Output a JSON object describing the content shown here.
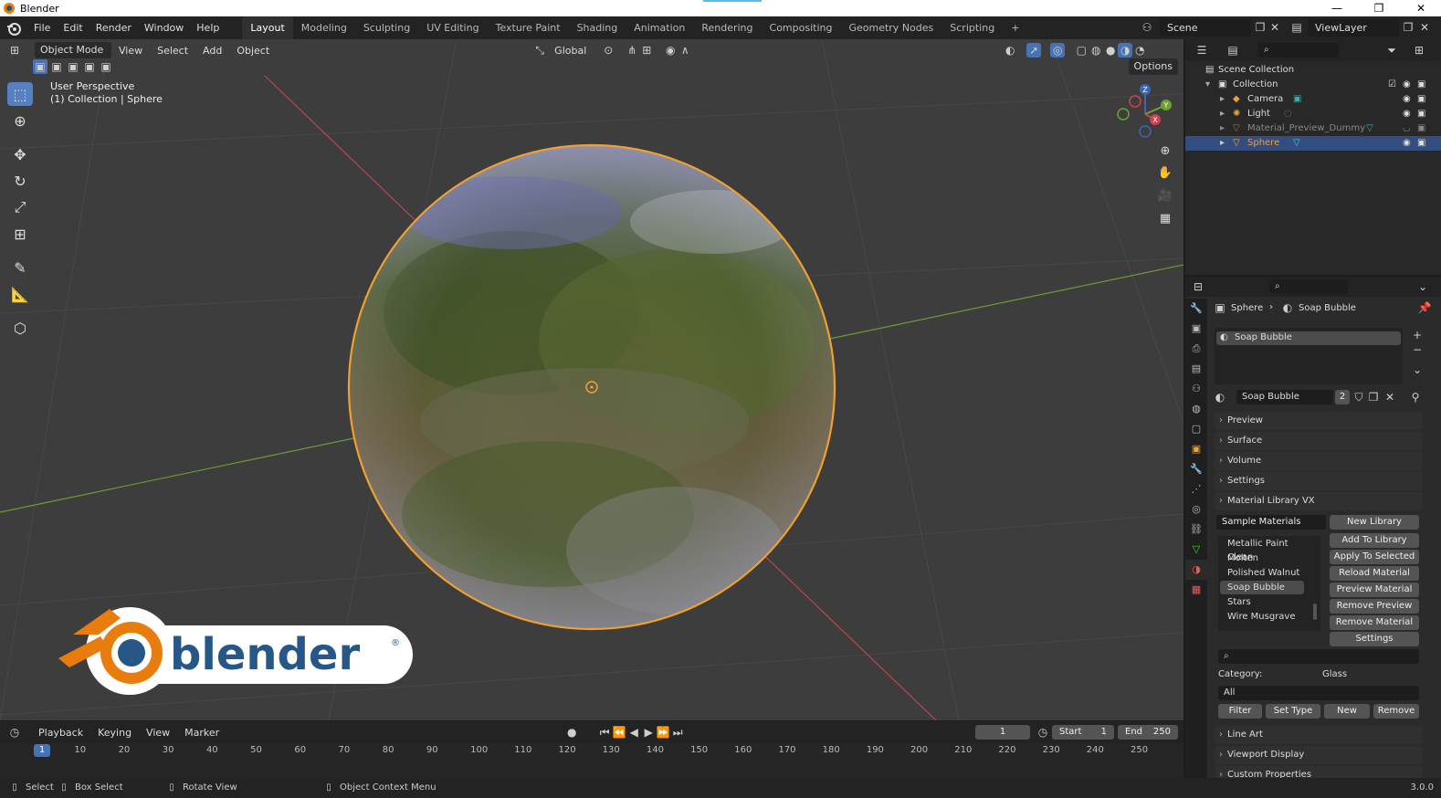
{
  "titlebar": {
    "title": "Blender",
    "minimize": "—",
    "maximize": "❐",
    "close": "✕"
  },
  "menu": [
    "File",
    "Edit",
    "Render",
    "Window",
    "Help"
  ],
  "workspaces": [
    "Layout",
    "Modeling",
    "Sculpting",
    "UV Editing",
    "Texture Paint",
    "Shading",
    "Animation",
    "Rendering",
    "Compositing",
    "Geometry Nodes",
    "Scripting",
    "+"
  ],
  "scene": {
    "label": "Scene",
    "view_layer": "ViewLayer"
  },
  "viewport": {
    "mode": "Object Mode",
    "menus": [
      "View",
      "Select",
      "Add",
      "Object"
    ],
    "transform": "Global",
    "options": "Options",
    "perspective": "User Perspective",
    "collection_info": "(1) Collection | Sphere",
    "gizmo_axes": [
      "Z",
      "Y",
      "X"
    ]
  },
  "logo": {
    "text": "blender",
    "mark": "®"
  },
  "outliner": {
    "items": [
      {
        "label": "Scene Collection"
      },
      {
        "label": "Collection"
      },
      {
        "label": "Camera"
      },
      {
        "label": "Light"
      },
      {
        "label": "Material_Preview_Dummy"
      },
      {
        "label": "Sphere"
      }
    ]
  },
  "properties": {
    "breadcrumb": {
      "object": "Sphere",
      "material": "Soap Bubble"
    },
    "slot": "Soap Bubble",
    "material_name": "Soap Bubble",
    "users": "2",
    "panels": [
      "Preview",
      "Surface",
      "Volume",
      "Settings",
      "Material Library VX"
    ],
    "library": {
      "selected": "Sample Materials",
      "materials": [
        "Metallic Paint Clean",
        "Molten",
        "Polished Walnut",
        "Soap Bubble",
        "Stars",
        "Wire Musgrave"
      ],
      "buttons": [
        "New Library",
        "Add To Library",
        "Apply To Selected",
        "Reload Material",
        "Preview Material",
        "Remove Preview",
        "Remove Material",
        "Settings"
      ],
      "category_label": "Category:",
      "category_value": "Glass",
      "filter_value": "All",
      "bottom_buttons": [
        "Filter",
        "Set Type",
        "New",
        "Remove"
      ]
    },
    "lower_panels": [
      "Line Art",
      "Viewport Display",
      "Custom Properties"
    ]
  },
  "timeline": {
    "menus": [
      "Playback",
      "Keying",
      "View",
      "Marker"
    ],
    "current_frame": "1",
    "start_label": "Start",
    "start": "1",
    "end_label": "End",
    "end": "250",
    "ticks": [
      "1",
      "10",
      "20",
      "30",
      "40",
      "50",
      "60",
      "70",
      "80",
      "90",
      "100",
      "110",
      "120",
      "130",
      "140",
      "150",
      "160",
      "170",
      "180",
      "190",
      "200",
      "210",
      "220",
      "230",
      "240",
      "250"
    ]
  },
  "statusbar": {
    "select": "Select",
    "box_select": "Box Select",
    "rotate": "Rotate View",
    "context": "Object Context Menu",
    "version": "3.0.0"
  }
}
